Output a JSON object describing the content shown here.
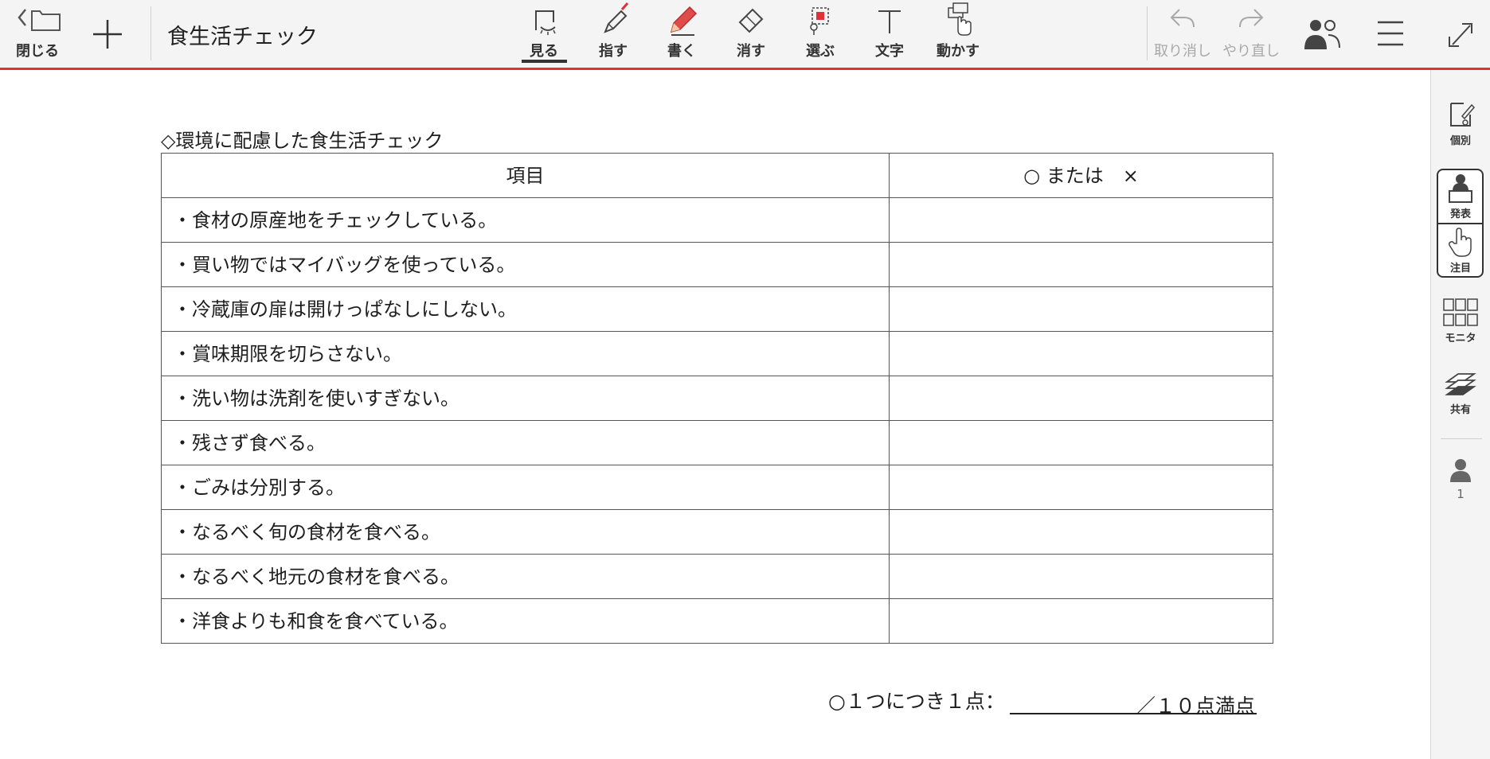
{
  "toolbar": {
    "close_label": "閉じる",
    "document_title": "食生活チェック",
    "tools": [
      {
        "label": "見る",
        "icon": "view-icon"
      },
      {
        "label": "指す",
        "icon": "pointer-pen-icon"
      },
      {
        "label": "書く",
        "icon": "pencil-icon"
      },
      {
        "label": "消す",
        "icon": "eraser-icon"
      },
      {
        "label": "選ぶ",
        "icon": "select-icon"
      },
      {
        "label": "文字",
        "icon": "text-icon"
      },
      {
        "label": "動かす",
        "icon": "move-hand-icon"
      }
    ],
    "active_tool": "見る",
    "undo_label": "取り消し",
    "redo_label": "やり直し"
  },
  "right_panel": {
    "individual_label": "個別",
    "present_label": "発表",
    "attention_label": "注目",
    "monitor_label": "モニタ",
    "share_label": "共有",
    "user_count": "1"
  },
  "document": {
    "heading": "◇環境に配慮した食生活チェック",
    "table": {
      "headers": [
        "項目",
        "○ または　×"
      ],
      "rows": [
        "・食材の原産地をチェックしている。",
        "・買い物ではマイバッグを使っている。",
        "・冷蔵庫の扉は開けっぱなしにしない。",
        "・賞味期限を切らさない。",
        "・洗い物は洗剤を使いすぎない。",
        "・残さず食べる。",
        "・ごみは分別する。",
        "・なるべく旬の食材を食べる。",
        "・なるべく地元の食材を食べる。",
        "・洋食よりも和食を食べている。"
      ]
    },
    "score_prefix": "○１つにつき１点：",
    "score_suffix": "／１０点満点"
  },
  "colors": {
    "accent": "#e0303a",
    "toolbar_bg": "#f4f4f4",
    "disabled": "#a8a8a8"
  }
}
